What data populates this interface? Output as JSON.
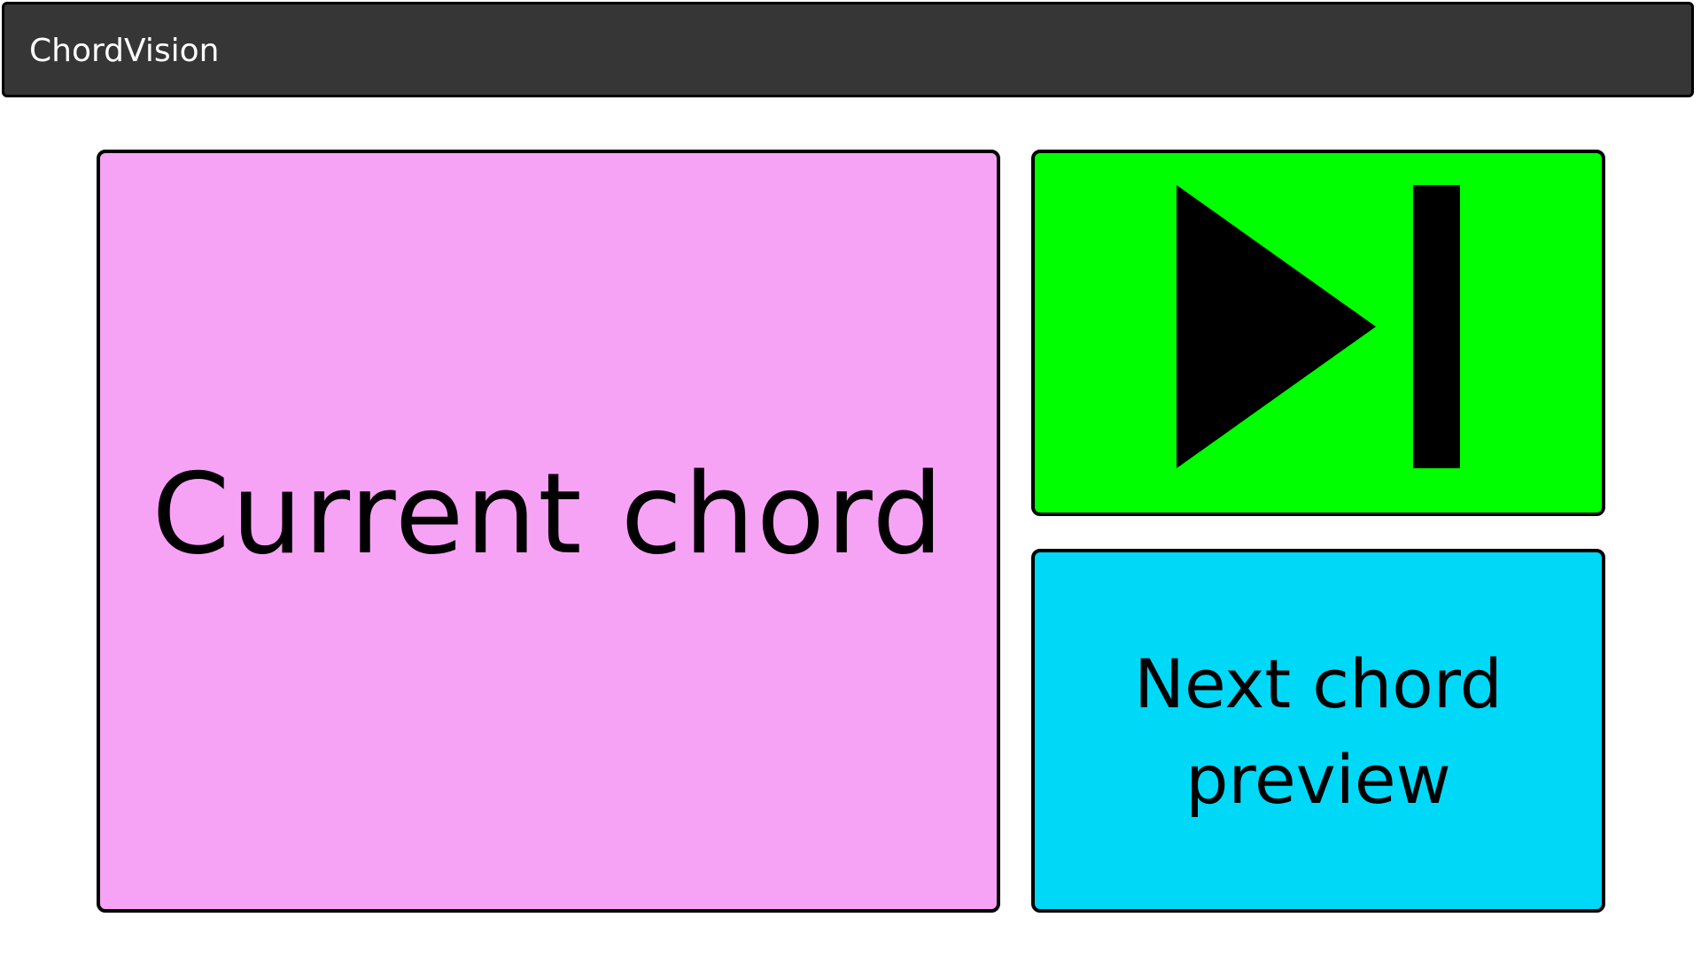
{
  "app": {
    "title": "ChordVision"
  },
  "current_chord": {
    "label": "Current chord",
    "background": "#f7a3f5"
  },
  "skip_button": {
    "icon": "skip-next-icon",
    "background": "#00ff00"
  },
  "next_chord": {
    "label": "Next chord preview",
    "background": "#00d8f8"
  },
  "colors": {
    "titlebar": "#363636",
    "border": "#000000"
  }
}
